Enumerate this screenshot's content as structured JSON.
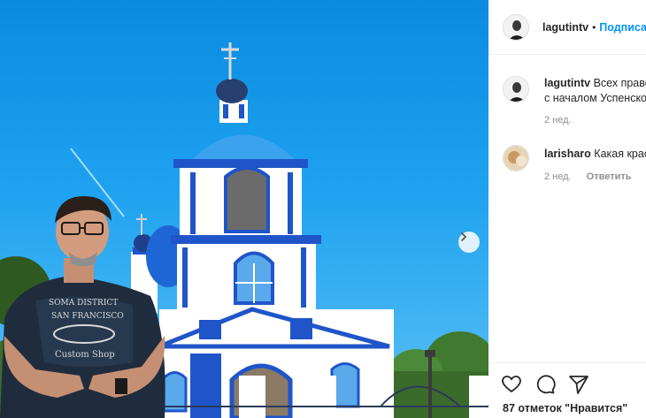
{
  "post": {
    "author": "lagutintv",
    "separator": "•",
    "follow_label": "Подписаться"
  },
  "comments": [
    {
      "user": "lagutintv",
      "text": "Всех православных",
      "text_line2": "с началом Успенского поста",
      "time": "2 нед.",
      "reply_label": ""
    },
    {
      "user": "larisharo",
      "text": "Какая красота",
      "time": "2 нед.",
      "reply_label": "Ответить"
    }
  ],
  "likes": {
    "text": "87 отметок \"Нравится\""
  },
  "icons": {
    "like": "heart-icon",
    "comment": "comment-bubble-icon",
    "share": "paper-plane-icon",
    "next": "chevron-right-icon"
  },
  "colors": {
    "link_blue": "#0095f6",
    "muted": "#8e8e8e",
    "sky": "#1ea2f0",
    "church_blue": "#1f55c8"
  }
}
